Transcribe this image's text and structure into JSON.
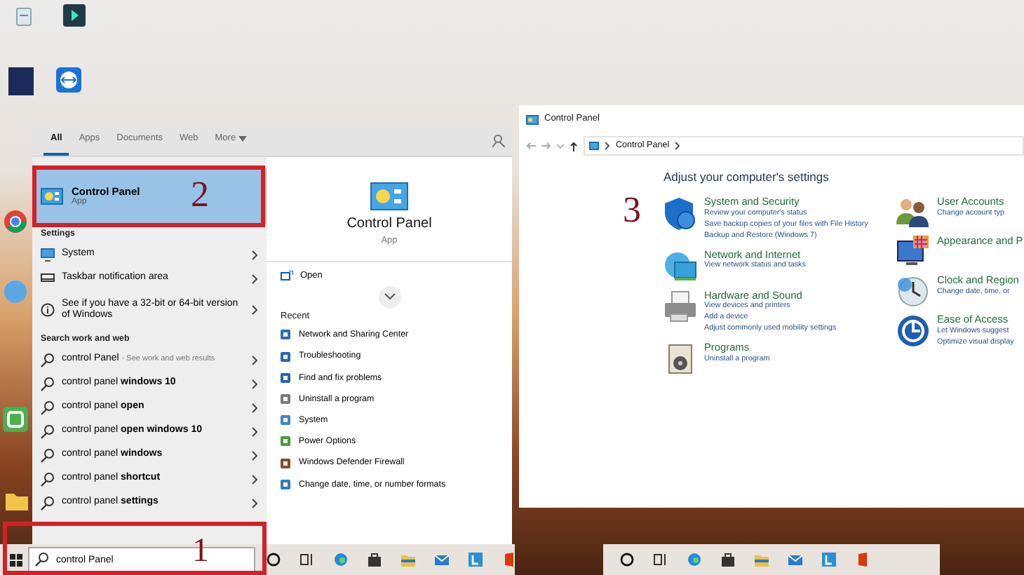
{
  "left_screen": {
    "search_tabs": [
      {
        "label": "All",
        "selected": true
      },
      {
        "label": "Apps",
        "selected": false
      },
      {
        "label": "Documents",
        "selected": false
      },
      {
        "label": "Web",
        "selected": false
      },
      {
        "label": "More",
        "selected": false,
        "has_menu": true
      }
    ],
    "best_match": {
      "title": "Control Panel",
      "subtitle": "App",
      "selected": true
    },
    "settings": {
      "heading": "Settings",
      "items": [
        {
          "kind": "display",
          "label": "System"
        },
        {
          "kind": "taskbar",
          "label": "Taskbar notification area"
        },
        {
          "kind": "info",
          "label": "See if you have a 32-bit or 64-bit version of Windows"
        }
      ]
    },
    "web": {
      "heading": "Search work and web",
      "suggestions": [
        {
          "text": "control Panel",
          "note": "- See work and web results"
        },
        {
          "text": "control panel **windows 10**"
        },
        {
          "text": "control panel **open**"
        },
        {
          "text": "control panel **open windows 10**"
        },
        {
          "text": "control panel **windows**"
        },
        {
          "text": "control panel **shortcut**"
        },
        {
          "text": "control panel **settings**"
        }
      ]
    },
    "preview": {
      "title": "Control Panel",
      "subtitle": "App",
      "actions": [
        {
          "label": "Open"
        }
      ],
      "recent_heading": "Recent",
      "recent": [
        "Network and Sharing Center",
        "Troubleshooting",
        "Find and fix problems",
        "Uninstall a program",
        "System",
        "Power Options",
        "Windows Defender Firewall",
        "Change date, time, or number formats"
      ]
    },
    "search_field": {
      "value": "control Panel"
    },
    "annotations": [
      "2",
      "1"
    ]
  },
  "right_screen": {
    "window": {
      "title": "Control Panel",
      "breadcrumb": [
        "Control Panel"
      ],
      "heading": "Adjust your computer's settings",
      "columns": [
        [
          {
            "kind": "shield",
            "title": "System and Security",
            "links": [
              "Review your computer's status",
              "Save backup copies of your files with File History",
              "Backup and Restore (Windows 7)"
            ]
          },
          {
            "kind": "network",
            "title": "Network and Internet",
            "links": [
              "View network status and tasks"
            ]
          },
          {
            "kind": "printer",
            "title": "Hardware and Sound",
            "links": [
              "View devices and printers",
              "Add a device",
              "Adjust commonly used mobility settings"
            ]
          },
          {
            "kind": "programs",
            "title": "Programs",
            "links": [
              "Uninstall a program"
            ]
          }
        ],
        [
          {
            "kind": "users",
            "title": "User Accounts",
            "links": [
              "Change account typ"
            ]
          },
          {
            "kind": "appearance",
            "title": "Appearance and P"
          },
          {
            "kind": "clock",
            "title": "Clock and Region",
            "links": [
              "Change date, time, or"
            ]
          },
          {
            "kind": "access",
            "title": "Ease of Access",
            "links": [
              "Let Windows suggest",
              "Optimize visual display"
            ]
          }
        ]
      ]
    },
    "annotation": "3"
  }
}
